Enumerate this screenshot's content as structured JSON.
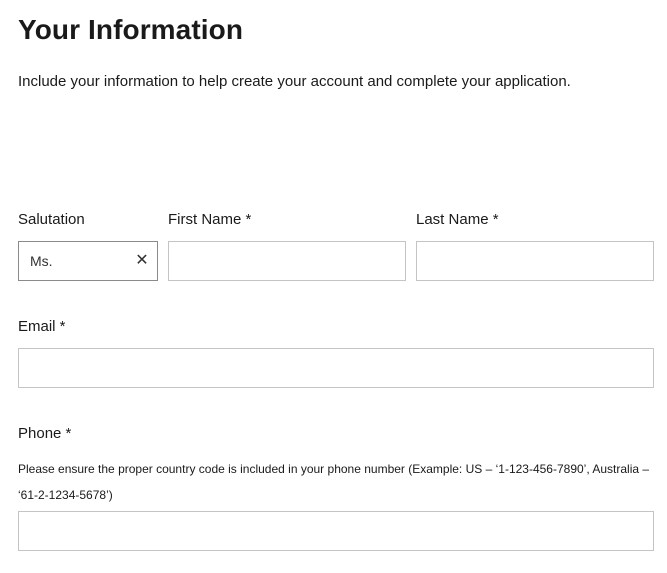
{
  "header": {
    "title": "Your Information",
    "intro": "Include your information to help create your account and complete your application."
  },
  "form": {
    "salutation": {
      "label": "Salutation",
      "value": "Ms.",
      "clear_icon": "close-icon"
    },
    "first_name": {
      "label": "First Name *",
      "value": ""
    },
    "last_name": {
      "label": "Last Name *",
      "value": ""
    },
    "email": {
      "label": "Email *",
      "value": ""
    },
    "phone": {
      "label": "Phone *",
      "hint": "Please ensure the proper country code is included in your phone number (Example: US – ‘1-123-456-7890’, Australia – ‘61-2-1234-5678’)",
      "value": ""
    }
  }
}
